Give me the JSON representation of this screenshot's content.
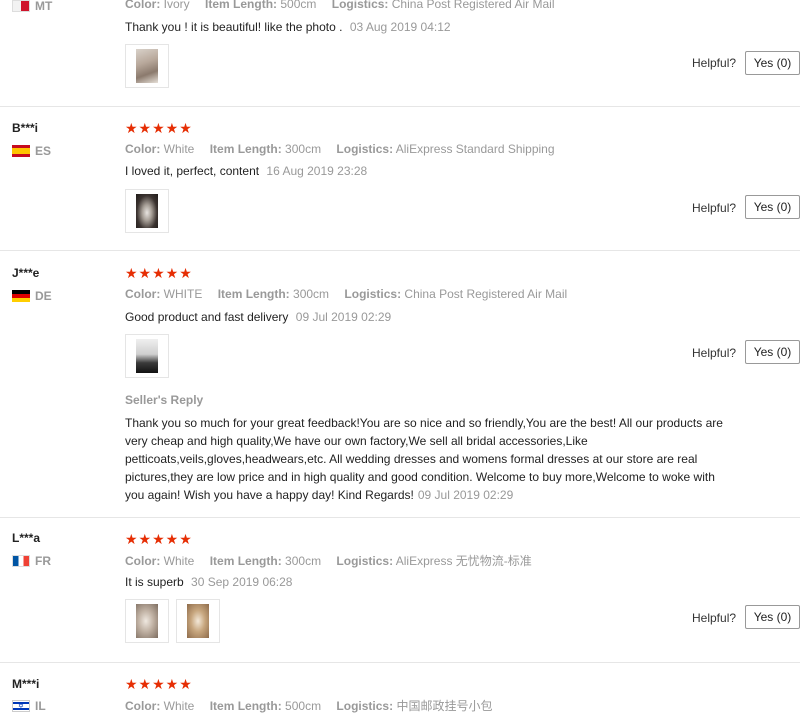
{
  "labels": {
    "color": "Color:",
    "item_length": "Item Length:",
    "logistics": "Logistics:",
    "helpful": "Helpful?",
    "sellers_reply": "Seller's Reply"
  },
  "reviews": [
    {
      "user": "",
      "country": "MT",
      "color": "Ivory",
      "item_length": "500cm",
      "logistics": "China Post Registered Air Mail",
      "text": "Thank you ! it is beautiful! like the photo .",
      "date": "03 Aug 2019 04:12",
      "yes_label": "Yes (0)"
    },
    {
      "user": "B***i",
      "country": "ES",
      "stars": "★★★★★",
      "color": "White",
      "item_length": "300cm",
      "logistics": "AliExpress Standard Shipping",
      "text": "I loved it, perfect, content",
      "date": "16 Aug 2019 23:28",
      "yes_label": "Yes (0)"
    },
    {
      "user": "J***e",
      "country": "DE",
      "stars": "★★★★★",
      "color": "WHITE",
      "item_length": "300cm",
      "logistics": "China Post Registered Air Mail",
      "text": "Good product and fast delivery",
      "date": "09 Jul 2019 02:29",
      "yes_label": "Yes (0)",
      "reply_lines": [
        "Thank you so much for your great feedback!You are so nice and so friendly,You are the best! All our products are",
        "very cheap and high quality,We have our own factory,We sell all bridal accessories,Like",
        "petticoats,veils,gloves,headwears,etc. All wedding dresses and womens formal dresses at our store are real",
        "pictures,they are low price and in high quality and good condition. Welcome to buy more,Welcome to woke with",
        "you again! Wish you have a happy day! Kind Regards!"
      ],
      "reply_date": "09 Jul 2019 02:29"
    },
    {
      "user": "L***a",
      "country": "FR",
      "stars": "★★★★★",
      "color": "White",
      "item_length": "300cm",
      "logistics": "AliExpress 无忧物流-标准",
      "text": "It is superb",
      "date": "30 Sep 2019 06:28",
      "yes_label": "Yes (0)"
    },
    {
      "user": "M***i",
      "country": "IL",
      "stars": "★★★★★",
      "color": "White",
      "item_length": "500cm",
      "logistics": "中国邮政挂号小包"
    }
  ]
}
